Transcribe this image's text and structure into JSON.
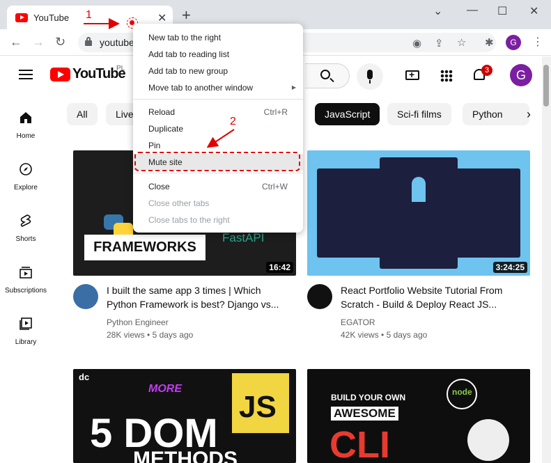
{
  "browser": {
    "tab_title": "YouTube",
    "url": "youtube"
  },
  "youtube": {
    "wordmark": "YouTube",
    "region": "PL",
    "notification_count": "3",
    "avatar_letter": "G",
    "sidebar": [
      {
        "label": "Home",
        "icon": "home-icon"
      },
      {
        "label": "Explore",
        "icon": "compass-icon"
      },
      {
        "label": "Shorts",
        "icon": "shorts-icon"
      },
      {
        "label": "Subscriptions",
        "icon": "subscriptions-icon"
      },
      {
        "label": "Library",
        "icon": "library-icon"
      }
    ],
    "chips": [
      "All",
      "Live",
      "JavaScript",
      "Sci-fi films",
      "Python"
    ],
    "videos": [
      {
        "title": "I built the same app 3 times | Which Python Framework is best? Django vs...",
        "channel": "Python Engineer",
        "views": "28K views",
        "age": "5 days ago",
        "duration": "16:42",
        "thumb_text": "FRAMEWORKS",
        "thumb_tag": "FastAPI"
      },
      {
        "title": "React Portfolio Website Tutorial From Scratch - Build & Deploy React JS...",
        "channel": "EGATOR",
        "views": "42K views",
        "age": "5 days ago",
        "duration": "3:24:25"
      },
      {
        "thumb_big": "5 DOM",
        "thumb_sub": "METHODS",
        "thumb_more": "MORE",
        "thumb_js": "JS",
        "thumb_dc": "dc"
      },
      {
        "thumb_line1": "BUILD YOUR OWN",
        "thumb_line2": "AWESOME",
        "thumb_line3": "CLI",
        "thumb_node": "node"
      }
    ]
  },
  "context_menu": {
    "items": [
      {
        "label": "New tab to the right",
        "shortcut": ""
      },
      {
        "label": "Add tab to reading list",
        "shortcut": ""
      },
      {
        "label": "Add tab to new group",
        "shortcut": ""
      },
      {
        "label": "Move tab to another window",
        "shortcut": ""
      },
      {
        "label": "Reload",
        "shortcut": "Ctrl+R"
      },
      {
        "label": "Duplicate",
        "shortcut": ""
      },
      {
        "label": "Pin",
        "shortcut": ""
      },
      {
        "label": "Mute site",
        "shortcut": ""
      },
      {
        "label": "Close",
        "shortcut": "Ctrl+W"
      },
      {
        "label": "Close other tabs",
        "shortcut": ""
      },
      {
        "label": "Close tabs to the right",
        "shortcut": ""
      }
    ]
  },
  "annotations": {
    "step1": "1",
    "step2": "2",
    "color": "#e00000"
  }
}
